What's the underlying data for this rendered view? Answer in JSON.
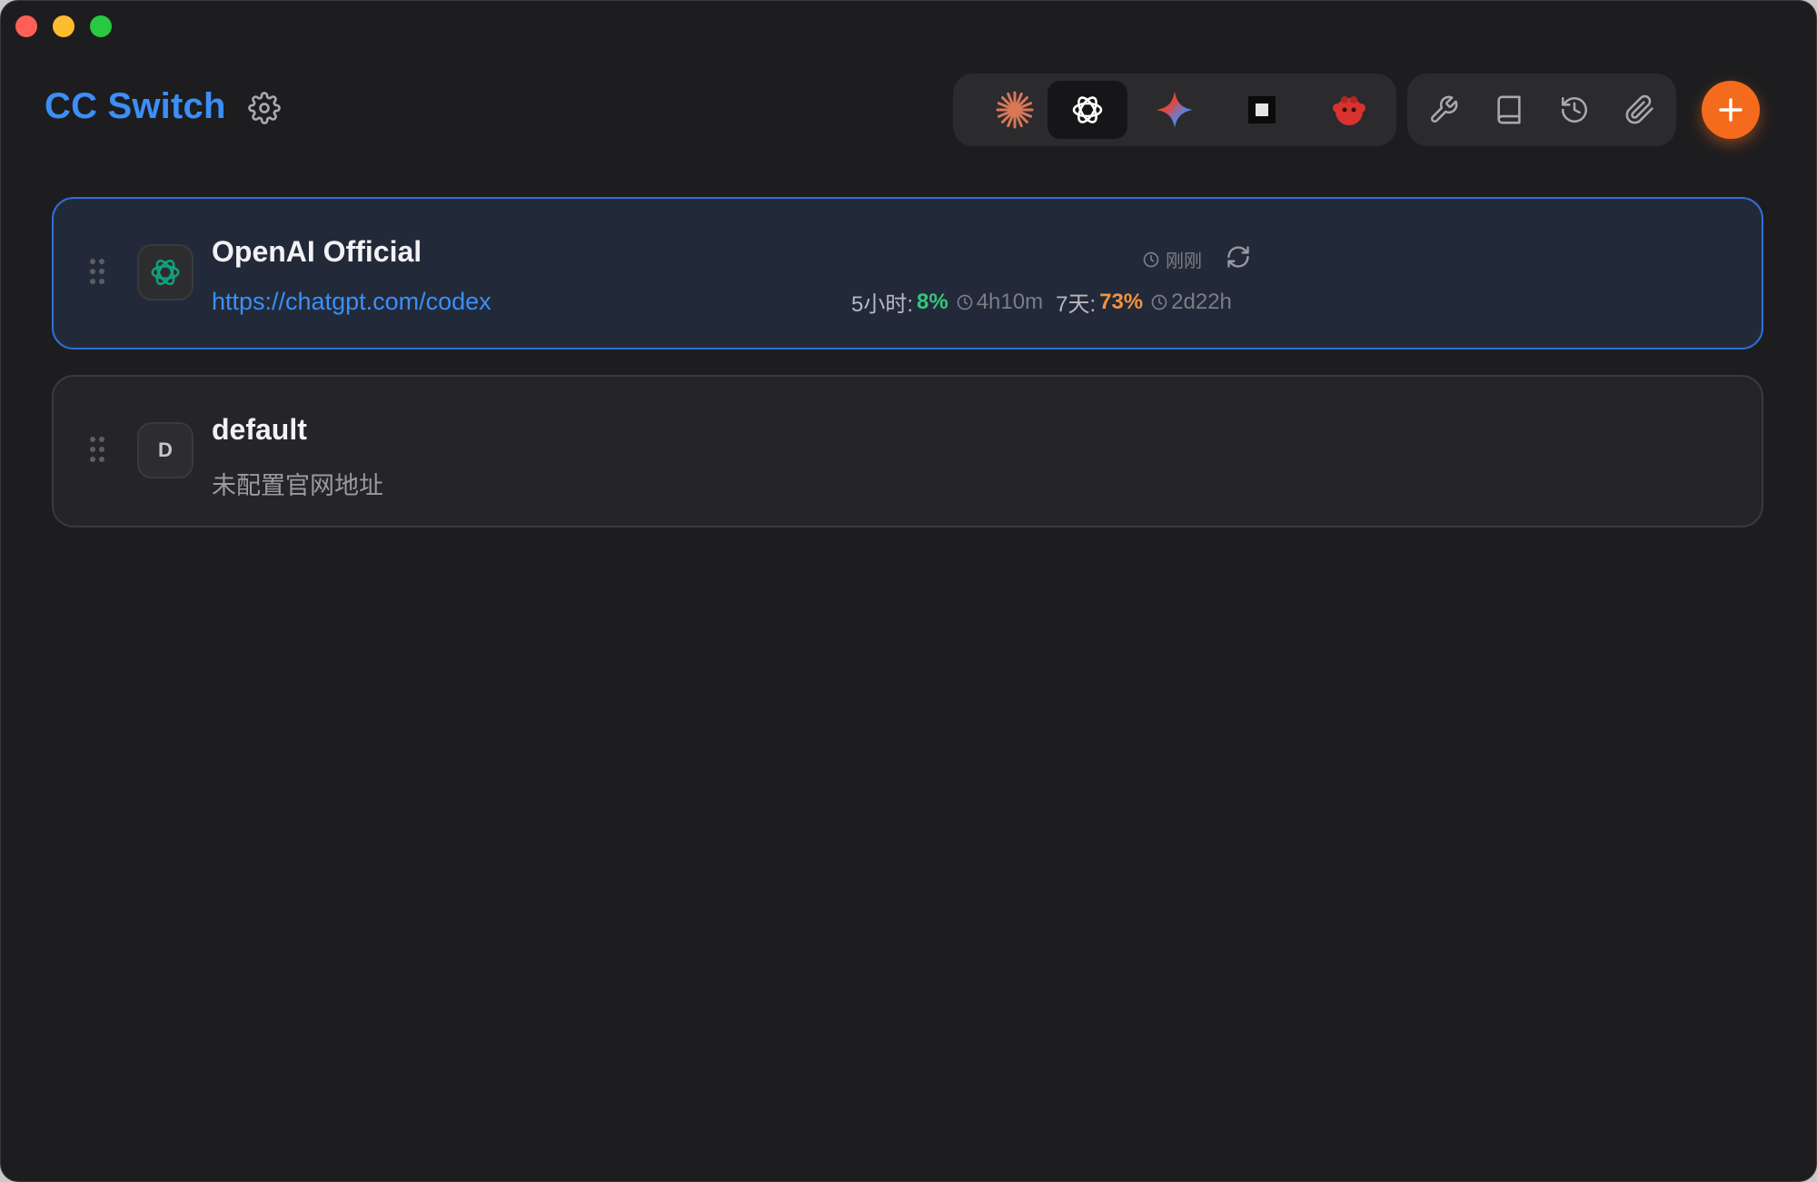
{
  "window": {
    "title": "CC Switch",
    "settings_icon": "gear-icon"
  },
  "app_switcher": {
    "selected": "codex",
    "apps": [
      {
        "id": "claude",
        "icon": "claude-starburst-icon",
        "color": "#d97757"
      },
      {
        "id": "codex",
        "icon": "openai-icon",
        "color": "#ffffff"
      },
      {
        "id": "gemini",
        "icon": "gemini-sparkle-icon",
        "color": "#4a8af4"
      },
      {
        "id": "terminal",
        "icon": "square-block-icon",
        "color": "#e5e5e5"
      },
      {
        "id": "mascot",
        "icon": "red-mascot-icon",
        "color": "#e03a3a"
      }
    ]
  },
  "tools": [
    {
      "id": "tools",
      "icon": "wrench-icon"
    },
    {
      "id": "docs",
      "icon": "book-icon"
    },
    {
      "id": "history",
      "icon": "history-icon"
    },
    {
      "id": "attachments",
      "icon": "paperclip-icon"
    }
  ],
  "add_button_icon": "plus-icon",
  "providers": [
    {
      "name": "OpenAI Official",
      "url": "https://chatgpt.com/codex",
      "icon": "openai-icon",
      "active": true,
      "refreshed": "刚刚",
      "usage": {
        "five_hour_label": "5小时:",
        "five_hour_pct": "8%",
        "five_hour_reset": "4h10m",
        "seven_day_label": "7天:",
        "seven_day_pct": "73%",
        "seven_day_reset": "2d22h"
      }
    },
    {
      "name": "default",
      "icon_letter": "D",
      "subtitle": "未配置官网地址",
      "active": false
    }
  ],
  "colors": {
    "accent": "#3b8ff6",
    "add_button": "#f46b1d",
    "usage_good": "#34c77b",
    "usage_warn": "#f4923a"
  }
}
